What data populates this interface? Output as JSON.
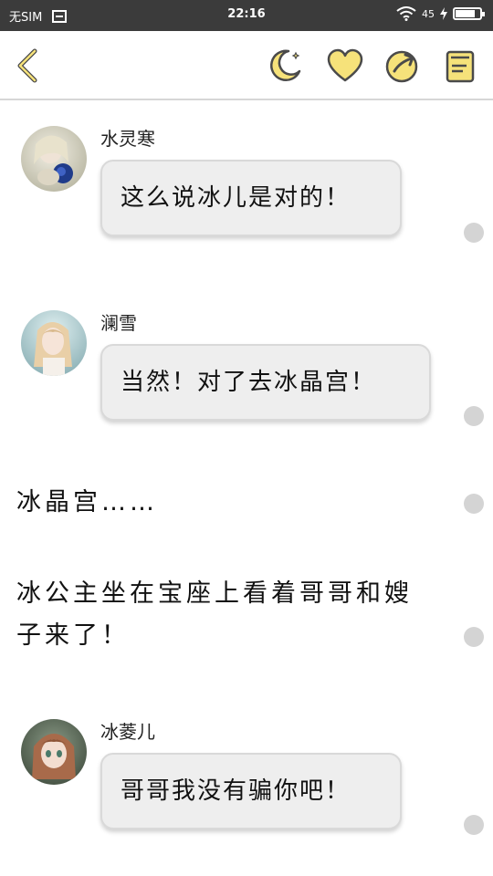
{
  "status_bar": {
    "carrier": "无SIM",
    "time": "22:16",
    "battery_label": "45",
    "battery_level": 0.8
  },
  "header": {
    "back_icon": "chevron-left-icon",
    "icons": [
      "moon-icon",
      "heart-icon",
      "share-icon",
      "book-icon"
    ],
    "accent_color": "#f6e27a",
    "stroke_color": "#4a4a4a"
  },
  "messages": [
    {
      "type": "chat",
      "speaker": "水灵寒",
      "text": "这么说冰儿是对的！"
    },
    {
      "type": "chat",
      "speaker": "澜雪",
      "text": "当然！对了去冰晶宫！"
    },
    {
      "type": "narration",
      "lines": [
        "冰晶宫……"
      ]
    },
    {
      "type": "narration",
      "lines": [
        "冰公主坐在宝座上看着哥哥和嫂",
        "子来了！"
      ]
    },
    {
      "type": "chat",
      "speaker": "冰菱儿",
      "text": "哥哥我没有骗你吧！"
    }
  ]
}
